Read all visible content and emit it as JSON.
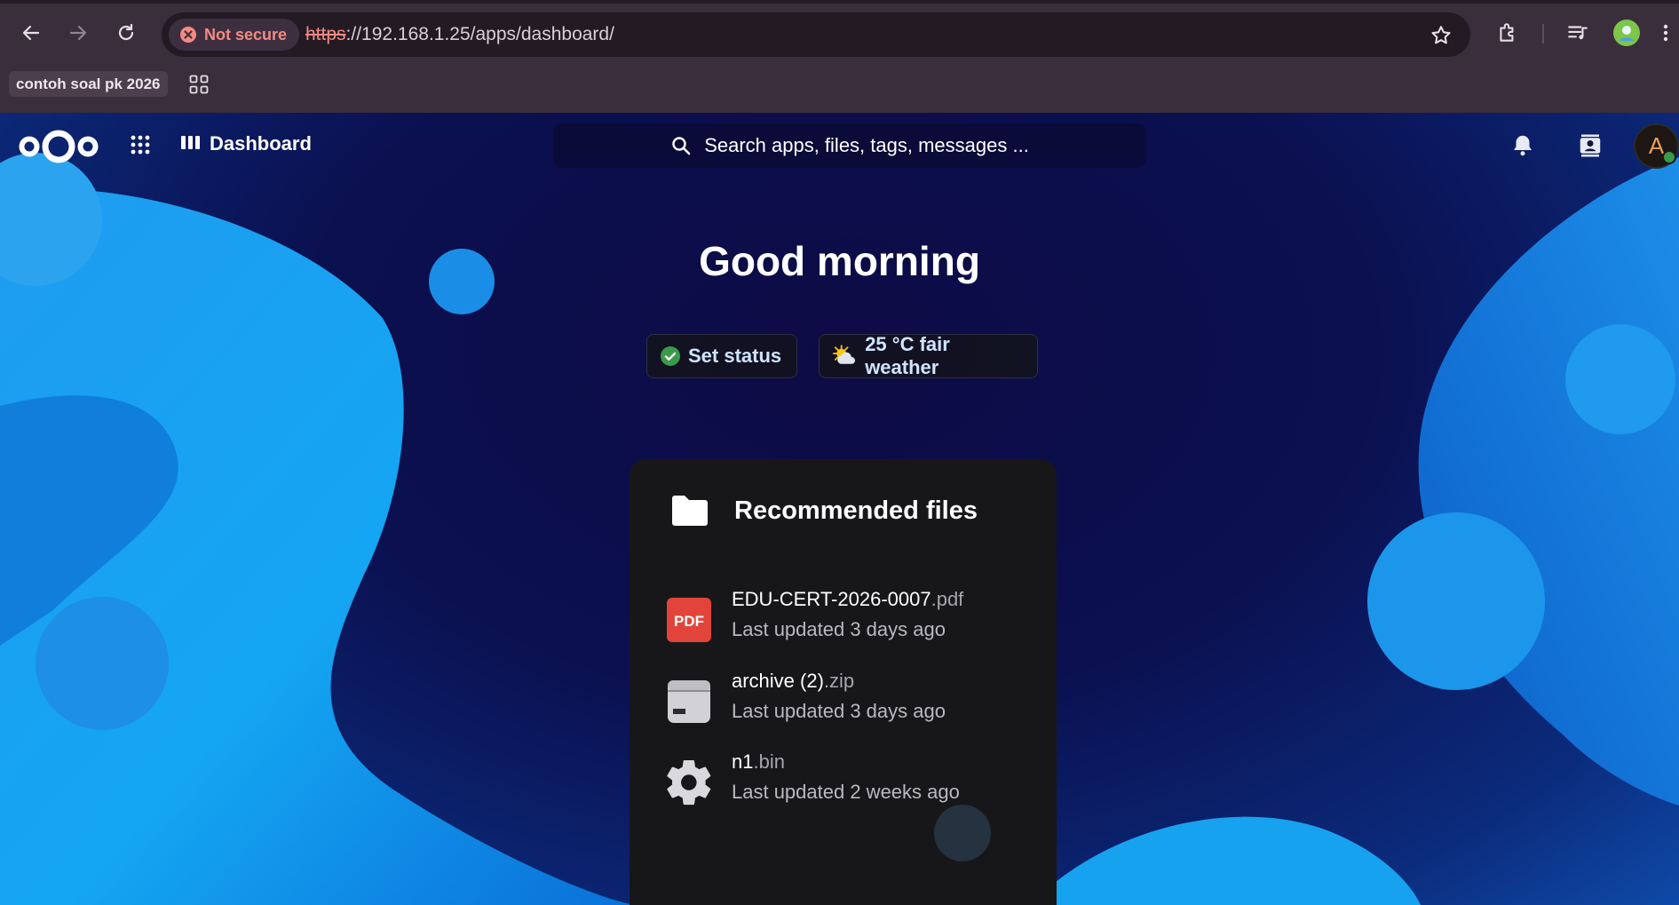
{
  "browser": {
    "security_label": "Not secure",
    "url_scheme": "https",
    "url_rest": "://192.168.1.25/apps/dashboard/",
    "bookmark_label": "contoh soal pk 2026"
  },
  "header": {
    "app_name": "Dashboard",
    "search_placeholder": "Search apps, files, tags, messages ...",
    "avatar_initial": "A"
  },
  "main": {
    "greeting": "Good morning",
    "set_status_label": "Set status",
    "weather_label": "25 °C fair weather"
  },
  "recommended": {
    "title": "Recommended files",
    "files": [
      {
        "name": "EDU-CERT-2026-0007",
        "ext": ".pdf",
        "updated": "Last updated 3 days ago",
        "icon": "pdf-icon"
      },
      {
        "name": "archive (2)",
        "ext": ".zip",
        "updated": "Last updated 3 days ago",
        "icon": "archive-icon"
      },
      {
        "name": "n1",
        "ext": ".bin",
        "updated": "Last updated 2 weeks ago",
        "icon": "gear-icon"
      }
    ]
  },
  "colors": {
    "brand_blue": "#1a9bf0",
    "status_green": "#3a9b4a",
    "pdf_red": "#e2443c"
  }
}
